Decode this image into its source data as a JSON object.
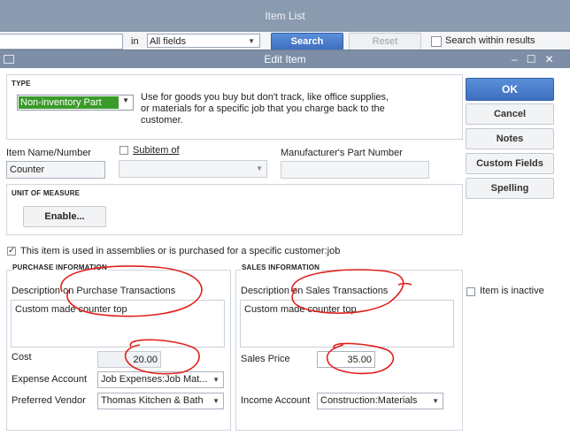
{
  "item_list": {
    "title": "Item List",
    "in_label": "in",
    "field_select": "All fields",
    "search_button": "Search",
    "reset_button": "Reset",
    "search_within_label": "Search within results"
  },
  "dialog": {
    "title": "Edit Item",
    "controls": {
      "minimize": "–",
      "restore": "☐",
      "close": "✕"
    },
    "type": {
      "section_title": "TYPE",
      "selected": "Non-inventory Part",
      "description": "Use for goods you buy but don't track, like office supplies, or materials for a specific job that you charge back to the customer."
    },
    "item_name_label": "Item Name/Number",
    "item_name_value": "Counter",
    "subitem_label": "Subitem of",
    "manufacturer_label": "Manufacturer's Part Number",
    "unit_of_measure": {
      "section_title": "UNIT OF MEASURE",
      "enable_button": "Enable..."
    },
    "assemblies_label": "This item is used in assemblies or is purchased for a specific customer:job",
    "purchase": {
      "section_title": "PURCHASE INFORMATION",
      "desc_label": "Description on Purchase Transactions",
      "desc_value": "Custom made counter top",
      "cost_label": "Cost",
      "cost_value": "20.00",
      "expense_label": "Expense Account",
      "expense_value": "Job Expenses:Job Mat...",
      "vendor_label": "Preferred Vendor",
      "vendor_value": "Thomas Kitchen & Bath"
    },
    "sales": {
      "section_title": "SALES INFORMATION",
      "desc_label": "Description on Sales Transactions",
      "desc_value": "Custom made counter top",
      "price_label": "Sales Price",
      "price_value": "35.00",
      "income_label": "Income Account",
      "income_value": "Construction:Materials"
    },
    "buttons": {
      "ok": "OK",
      "cancel": "Cancel",
      "notes": "Notes",
      "custom_fields": "Custom Fields",
      "spelling": "Spelling"
    },
    "inactive_label": "Item is inactive",
    "colors": {
      "ok_blue": "#3e6fbf",
      "type_green": "#3a9a2a",
      "annotation_red": "#e0201a"
    }
  }
}
